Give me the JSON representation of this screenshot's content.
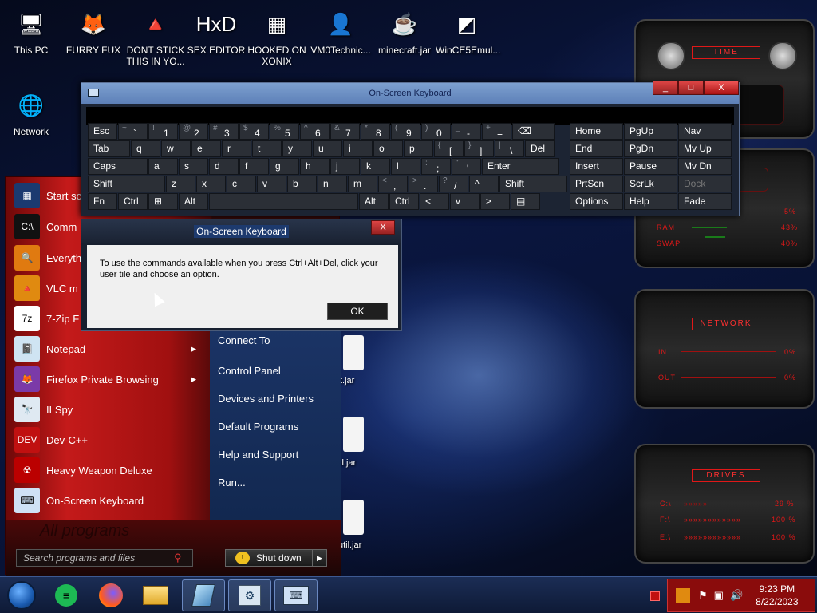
{
  "desktop": {
    "icons": [
      {
        "label": "This PC",
        "glyph": "🖥"
      },
      {
        "label": "FURRY FUX",
        "glyph": "🦊"
      },
      {
        "label": "DONT STICK THIS IN YO...",
        "glyph": "🔺"
      },
      {
        "label": "SEX EDITOR",
        "glyph": "HxD"
      },
      {
        "label": "HOOKED ON XONIX",
        "glyph": "▦"
      },
      {
        "label": "VM0Technic...",
        "glyph": "👤"
      },
      {
        "label": "minecraft.jar",
        "glyph": "☕"
      },
      {
        "label": "WinCE5Emul...",
        "glyph": "◩"
      },
      {
        "label": "Network",
        "glyph": "🌐"
      },
      {
        "label": "Di",
        "glyph": ""
      }
    ],
    "behind_jars": [
      "t.jar",
      "il.jar",
      "util.jar"
    ]
  },
  "osk": {
    "title": "On-Screen Keyboard",
    "window_buttons": {
      "min": "_",
      "max": "□",
      "close": "X"
    },
    "rows": [
      [
        {
          "label": "Esc"
        },
        {
          "sub": "~",
          "main": "`"
        },
        {
          "sub": "!",
          "main": "1"
        },
        {
          "sub": "@",
          "main": "2"
        },
        {
          "sub": "#",
          "main": "3"
        },
        {
          "sub": "$",
          "main": "4"
        },
        {
          "sub": "%",
          "main": "5"
        },
        {
          "sub": "^",
          "main": "6"
        },
        {
          "sub": "&",
          "main": "7"
        },
        {
          "sub": "*",
          "main": "8"
        },
        {
          "sub": "(",
          "main": "9"
        },
        {
          "sub": ")",
          "main": "0"
        },
        {
          "sub": "_",
          "main": "-"
        },
        {
          "sub": "+",
          "main": "="
        },
        {
          "label": "⌫"
        }
      ],
      [
        {
          "label": "Tab"
        },
        {
          "label": "q"
        },
        {
          "label": "w"
        },
        {
          "label": "e"
        },
        {
          "label": "r"
        },
        {
          "label": "t"
        },
        {
          "label": "y"
        },
        {
          "label": "u"
        },
        {
          "label": "i"
        },
        {
          "label": "o"
        },
        {
          "label": "p"
        },
        {
          "sub": "{",
          "main": "["
        },
        {
          "sub": "}",
          "main": "]"
        },
        {
          "sub": "|",
          "main": "\\"
        },
        {
          "label": "Del"
        }
      ],
      [
        {
          "label": "Caps"
        },
        {
          "label": "a"
        },
        {
          "label": "s"
        },
        {
          "label": "d"
        },
        {
          "label": "f"
        },
        {
          "label": "g"
        },
        {
          "label": "h"
        },
        {
          "label": "j"
        },
        {
          "label": "k"
        },
        {
          "label": "l"
        },
        {
          "sub": ":",
          "main": ";"
        },
        {
          "sub": "\"",
          "main": "'"
        },
        {
          "label": "Enter"
        }
      ],
      [
        {
          "label": "Shift"
        },
        {
          "label": "z"
        },
        {
          "label": "x"
        },
        {
          "label": "c"
        },
        {
          "label": "v"
        },
        {
          "label": "b"
        },
        {
          "label": "n"
        },
        {
          "label": "m"
        },
        {
          "sub": "<",
          "main": ","
        },
        {
          "sub": ">",
          "main": "."
        },
        {
          "sub": "?",
          "main": "/"
        },
        {
          "label": "^"
        },
        {
          "label": "Shift"
        }
      ],
      [
        {
          "label": "Fn"
        },
        {
          "label": "Ctrl"
        },
        {
          "label": "⊞"
        },
        {
          "label": "Alt"
        },
        {
          "label": ""
        },
        {
          "label": "Alt"
        },
        {
          "label": "Ctrl"
        },
        {
          "label": "<"
        },
        {
          "label": "v"
        },
        {
          "label": ">"
        },
        {
          "label": "▤"
        }
      ]
    ],
    "nav_keys": [
      [
        "Home",
        "PgUp",
        "Nav"
      ],
      [
        "End",
        "PgDn",
        "Mv Up"
      ],
      [
        "Insert",
        "Pause",
        "Mv Dn"
      ],
      [
        "PrtScn",
        "ScrLk",
        "Dock"
      ],
      [
        "Options",
        "Help",
        "Fade"
      ]
    ]
  },
  "dialog": {
    "title": "On-Screen Keyboard",
    "message": "To use the commands available when you press Ctrl+Alt+Del, click your user tile and choose an option.",
    "ok_label": "OK",
    "close_label": "X"
  },
  "start_menu": {
    "programs": [
      {
        "label": "Start sc",
        "glyph": "▦",
        "arrow": false
      },
      {
        "label": "Comm",
        "glyph": "C:\\",
        "arrow": false
      },
      {
        "label": "Everyth",
        "glyph": "🔍",
        "arrow": false
      },
      {
        "label": "VLC m",
        "glyph": "🔺",
        "arrow": false
      },
      {
        "label": "7-Zip F",
        "glyph": "7z",
        "arrow": false
      },
      {
        "label": "Notepad",
        "glyph": "📓",
        "arrow": true
      },
      {
        "label": "Firefox Private Browsing",
        "glyph": "🦊",
        "arrow": true
      },
      {
        "label": "ILSpy",
        "glyph": "🔭",
        "arrow": false
      },
      {
        "label": "Dev-C++",
        "glyph": "DEV",
        "arrow": false
      },
      {
        "label": "Heavy Weapon Deluxe",
        "glyph": "☢",
        "arrow": false
      },
      {
        "label": "On-Screen Keyboard",
        "glyph": "⌨",
        "arrow": false
      }
    ],
    "right_links": [
      "Connect To",
      "Control Panel",
      "Devices and Printers",
      "Default Programs",
      "Help and Support",
      "Run..."
    ],
    "all_programs": "All programs",
    "search_placeholder": "Search programs and files",
    "shutdown_label": "Shut down"
  },
  "gadgets": {
    "time": {
      "title": "TIME"
    },
    "cpu": {
      "title": "CPU",
      "rows": [
        {
          "label": "",
          "value": "5%"
        },
        {
          "label": "RAM",
          "value": "43%"
        },
        {
          "label": "SWAP",
          "value": "40%"
        }
      ]
    },
    "network": {
      "title": "NETWORK",
      "rows": [
        {
          "label": "IN",
          "value": "0%"
        },
        {
          "label": "OUT",
          "value": "0%"
        }
      ]
    },
    "drives": {
      "title": "DRIVES",
      "rows": [
        {
          "label": "C:\\",
          "value": "29 %"
        },
        {
          "label": "F:\\",
          "value": "100 %"
        },
        {
          "label": "E:\\",
          "value": "100 %"
        }
      ]
    }
  },
  "taskbar": {
    "clock_time": "9:23 PM",
    "clock_date": "8/22/2023",
    "apps": [
      "start-orb",
      "spotify",
      "firefox",
      "file-explorer",
      "notepad",
      "control-panel",
      "on-screen-keyboard"
    ]
  },
  "colors": {
    "accent_red": "#e01818",
    "start_red": "#b01414",
    "osk_title": "#6d90c4"
  }
}
